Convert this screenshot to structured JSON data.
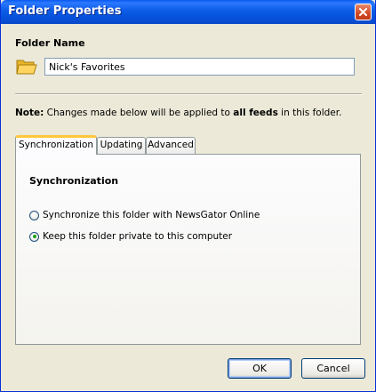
{
  "window": {
    "title": "Folder Properties"
  },
  "folder_name": {
    "heading": "Folder Name",
    "value": "Nick's Favorites"
  },
  "note": {
    "prefix": "Note:",
    "text_before": " Changes made below will be applied to ",
    "emphasis": "all feeds",
    "text_after": " in this folder."
  },
  "tabs": [
    {
      "label": "Synchronization",
      "active": true
    },
    {
      "label": "Updating",
      "active": false
    },
    {
      "label": "Advanced",
      "active": false
    }
  ],
  "sync_panel": {
    "title": "Synchronization",
    "options": [
      {
        "label": "Synchronize this folder with NewsGator Online",
        "checked": false
      },
      {
        "label": "Keep this folder private to this computer",
        "checked": true
      }
    ]
  },
  "buttons": {
    "ok": "OK",
    "cancel": "Cancel"
  },
  "colors": {
    "titlebar": "#0a5cf0",
    "tab_highlight": "#ffc83c",
    "radio_dot": "#21a121"
  }
}
